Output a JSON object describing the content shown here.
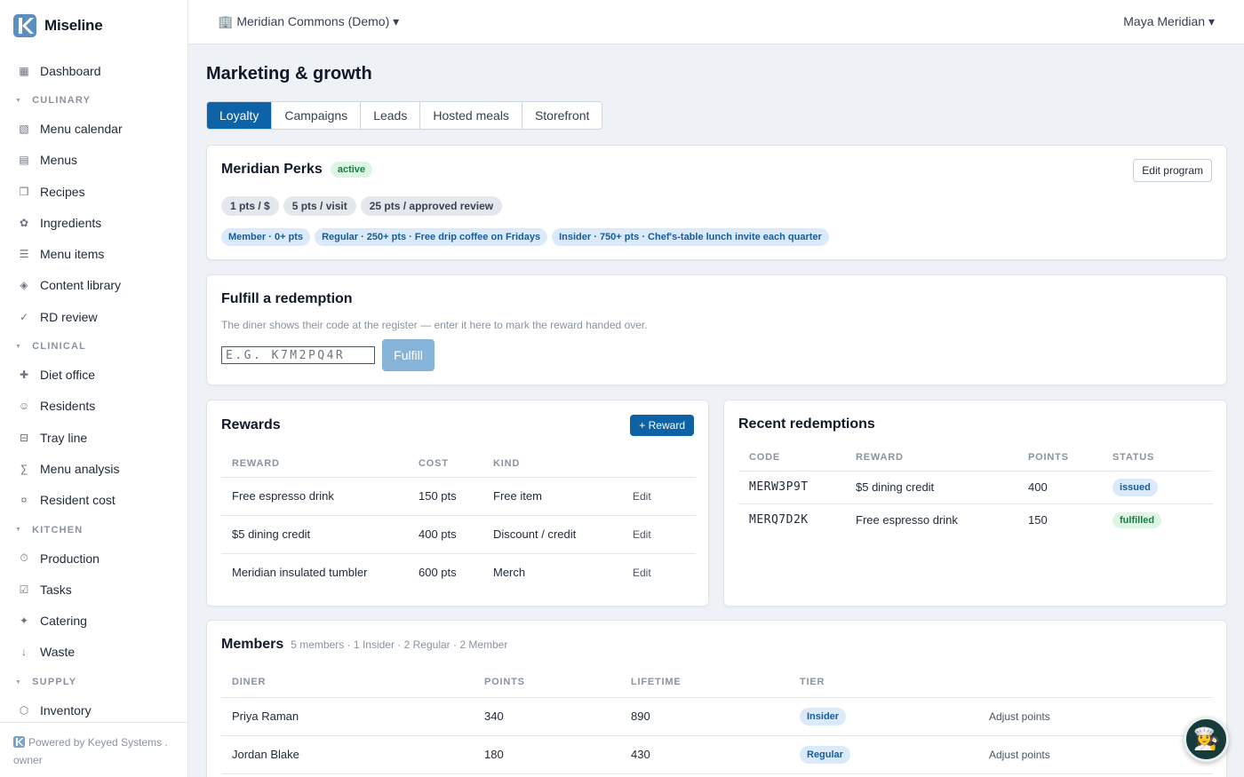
{
  "brand": {
    "name": "Miseline"
  },
  "sidebar": {
    "top": [
      {
        "label": "Dashboard",
        "icon": "▦"
      }
    ],
    "sections": [
      {
        "title": "CULINARY",
        "items": [
          {
            "label": "Menu calendar",
            "icon": "▧"
          },
          {
            "label": "Menus",
            "icon": "▤"
          },
          {
            "label": "Recipes",
            "icon": "❐"
          },
          {
            "label": "Ingredients",
            "icon": "✿"
          },
          {
            "label": "Menu items",
            "icon": "☰"
          },
          {
            "label": "Content library",
            "icon": "◈"
          },
          {
            "label": "RD review",
            "icon": "✓"
          }
        ]
      },
      {
        "title": "CLINICAL",
        "items": [
          {
            "label": "Diet office",
            "icon": "✚"
          },
          {
            "label": "Residents",
            "icon": "☺"
          },
          {
            "label": "Tray line",
            "icon": "⊟"
          },
          {
            "label": "Menu analysis",
            "icon": "∑"
          },
          {
            "label": "Resident cost",
            "icon": "¤"
          }
        ]
      },
      {
        "title": "KITCHEN",
        "items": [
          {
            "label": "Production",
            "icon": "⏱"
          },
          {
            "label": "Tasks",
            "icon": "☑"
          },
          {
            "label": "Catering",
            "icon": "✦"
          },
          {
            "label": "Waste",
            "icon": "↓"
          }
        ]
      },
      {
        "title": "SUPPLY",
        "items": [
          {
            "label": "Inventory",
            "icon": "⬡"
          }
        ]
      }
    ],
    "footer": {
      "powered": "Powered by Keyed Systems .",
      "role": "owner"
    }
  },
  "topbar": {
    "org": "🏢 Meridian Commons (Demo) ▾",
    "user": "Maya Meridian ▾"
  },
  "page": {
    "title": "Marketing & growth"
  },
  "tabs": [
    "Loyalty",
    "Campaigns",
    "Leads",
    "Hosted meals",
    "Storefront"
  ],
  "program": {
    "name": "Meridian Perks",
    "status": "active",
    "edit_label": "Edit program",
    "earn_rules": [
      "1 pts / $",
      "5 pts / visit",
      "25 pts / approved review"
    ],
    "tiers": [
      "Member · 0+ pts",
      "Regular · 250+ pts · Free drip coffee on Fridays",
      "Insider · 750+ pts · Chef's-table lunch invite each quarter"
    ]
  },
  "fulfill": {
    "title": "Fulfill a redemption",
    "hint": "The diner shows their code at the register — enter it here to mark the reward handed over.",
    "placeholder": "E.G. K7M2PQ4R",
    "button": "Fulfill"
  },
  "rewards": {
    "title": "Rewards",
    "add_label": "+ Reward",
    "columns": [
      "REWARD",
      "COST",
      "KIND"
    ],
    "rows": [
      {
        "reward": "Free espresso drink",
        "cost": "150 pts",
        "kind": "Free item",
        "action": "Edit"
      },
      {
        "reward": "$5 dining credit",
        "cost": "400 pts",
        "kind": "Discount / credit",
        "action": "Edit"
      },
      {
        "reward": "Meridian insulated tumbler",
        "cost": "600 pts",
        "kind": "Merch",
        "action": "Edit"
      }
    ]
  },
  "redemptions": {
    "title": "Recent redemptions",
    "columns": [
      "CODE",
      "REWARD",
      "POINTS",
      "STATUS"
    ],
    "rows": [
      {
        "code": "MERW3P9T",
        "reward": "$5 dining credit",
        "points": "400",
        "status": "issued"
      },
      {
        "code": "MERQ7D2K",
        "reward": "Free espresso drink",
        "points": "150",
        "status": "fulfilled"
      }
    ]
  },
  "members": {
    "title": "Members",
    "summary": "5 members · 1 Insider · 2 Regular · 2 Member",
    "columns": [
      "DINER",
      "POINTS",
      "LIFETIME",
      "TIER"
    ],
    "rows": [
      {
        "diner": "Priya Raman",
        "points": "340",
        "lifetime": "890",
        "tier": "Insider",
        "action": "Adjust points"
      },
      {
        "diner": "Jordan Blake",
        "points": "180",
        "lifetime": "430",
        "tier": "Regular",
        "action": "Adjust points"
      }
    ]
  },
  "fab": {
    "icon": "chef-icon",
    "glyph": "👩‍🍳"
  },
  "colors": {
    "accent": "#0d63a5",
    "success_bg": "#dcf5e4",
    "info_bg": "#dbeafb"
  }
}
